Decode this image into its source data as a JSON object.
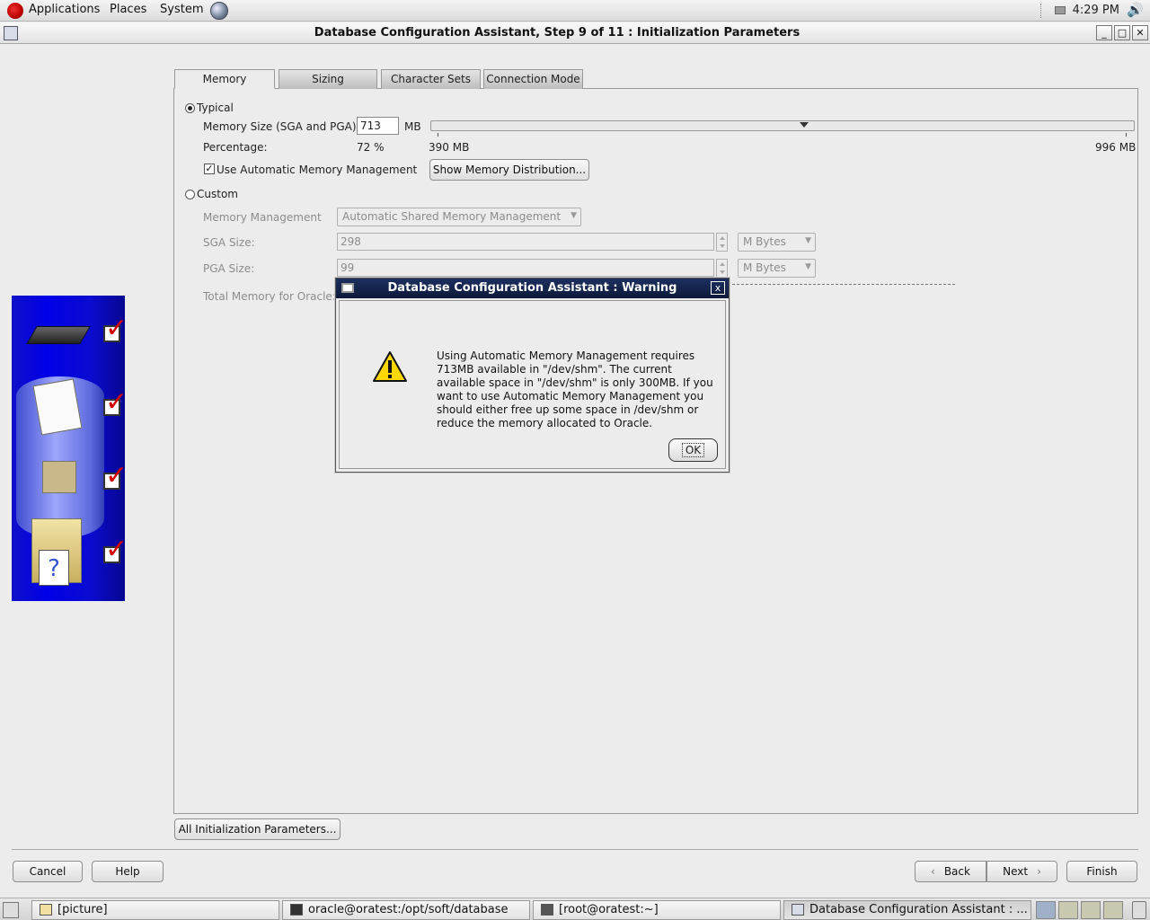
{
  "top_panel": {
    "menus": [
      "Applications",
      "Places",
      "System"
    ],
    "clock": "4:29 PM"
  },
  "window": {
    "title": "Database Configuration Assistant, Step 9 of 11 : Initialization Parameters",
    "controls": [
      "_",
      "□",
      "✕"
    ]
  },
  "tabs": [
    {
      "label": "Memory",
      "active": true
    },
    {
      "label": "Sizing",
      "active": false
    },
    {
      "label": "Character Sets",
      "active": false
    },
    {
      "label": "Connection Mode",
      "active": false
    }
  ],
  "memory": {
    "typical_label": "Typical",
    "typical_selected": true,
    "memory_size_label": "Memory Size (SGA and PGA):",
    "memory_size_value": "713",
    "memory_size_unit": "MB",
    "percentage_label": "Percentage:",
    "percentage_value": "72 %",
    "slider_min": "390 MB",
    "slider_max": "996 MB",
    "slider_value_mb": 713,
    "amm_label": "Use Automatic Memory Management",
    "amm_checked": true,
    "show_distribution_button": "Show Memory Distribution...",
    "custom_label": "Custom",
    "custom_selected": false,
    "memory_management_label": "Memory Management",
    "memory_management_value": "Automatic Shared Memory Management",
    "sga_label": "SGA Size:",
    "sga_value": "298",
    "sga_unit": "M Bytes",
    "pga_label": "PGA Size:",
    "pga_value": "99",
    "pga_unit": "M Bytes",
    "total_memory_label": "Total Memory for Oracle:"
  },
  "all_params_button": "All Initialization Parameters...",
  "footer": {
    "cancel": "Cancel",
    "help": "Help",
    "back": "Back",
    "next": "Next",
    "finish": "Finish"
  },
  "dialog": {
    "title": "Database Configuration Assistant : Warning",
    "close": "x",
    "message": "Using Automatic Memory Management requires 713MB available in \"/dev/shm\". The current available space in \"/dev/shm\" is only 300MB. If you want to use Automatic Memory Management you should either free up some space in /dev/shm or reduce the memory allocated to Oracle.",
    "ok": "OK"
  },
  "taskbar": {
    "tasks": [
      "[picture]",
      "oracle@oratest:/opt/soft/database",
      "[root@oratest:~]",
      "Database Configuration Assistant : ..."
    ]
  },
  "icons": {
    "warning": "warning-triangle-icon",
    "fedora": "fedora-logo-icon",
    "network": "network-icon",
    "volume": "volume-icon"
  }
}
